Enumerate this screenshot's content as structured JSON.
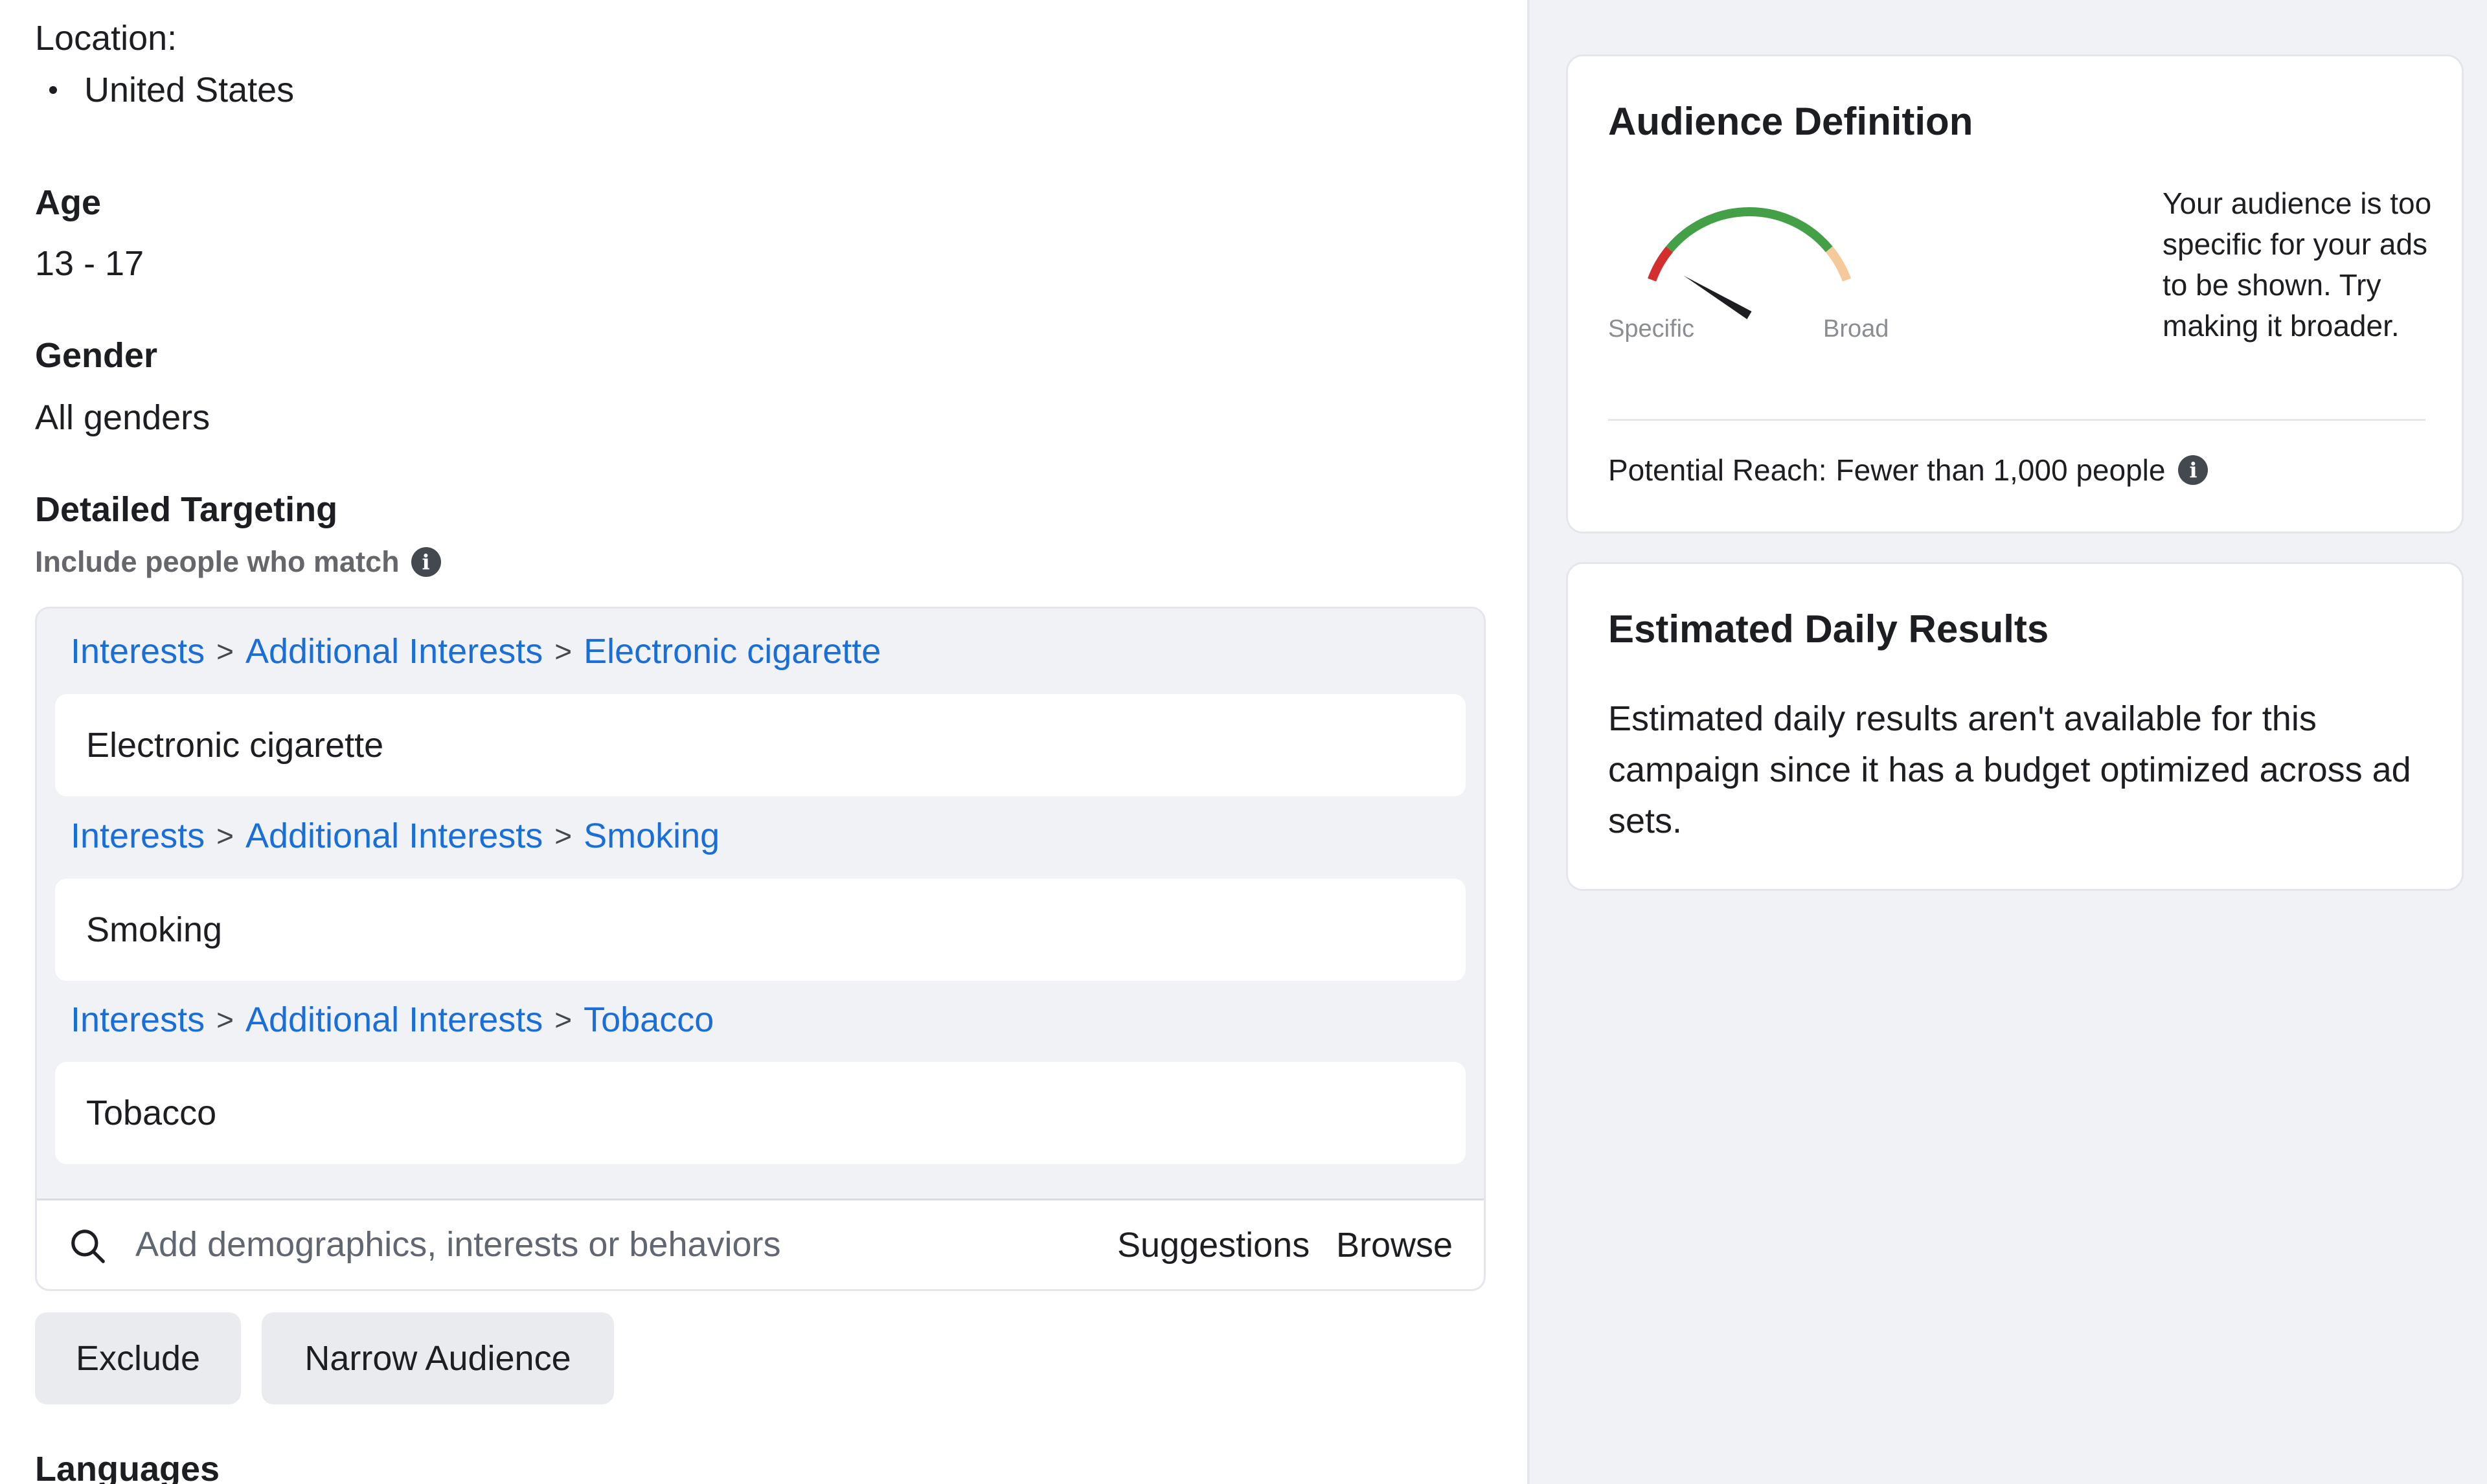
{
  "targeting": {
    "location_label": "Location:",
    "locations": [
      "United States"
    ],
    "age_label": "Age",
    "age_value": "13 - 17",
    "gender_label": "Gender",
    "gender_value": "All genders",
    "detailed_label": "Detailed Targeting",
    "include_label": "Include people who match",
    "interests": [
      {
        "path": [
          "Interests",
          "Additional Interests",
          "Electronic cigarette"
        ],
        "name": "Electronic cigarette"
      },
      {
        "path": [
          "Interests",
          "Additional Interests",
          "Smoking"
        ],
        "name": "Smoking"
      },
      {
        "path": [
          "Interests",
          "Additional Interests",
          "Tobacco"
        ],
        "name": "Tobacco"
      }
    ],
    "search_placeholder": "Add demographics, interests or behaviors",
    "suggestions_label": "Suggestions",
    "browse_label": "Browse",
    "exclude_label": "Exclude",
    "narrow_label": "Narrow Audience",
    "languages_label": "Languages"
  },
  "audience_definition": {
    "title": "Audience Definition",
    "gauge": {
      "specific_label": "Specific",
      "broad_label": "Broad",
      "level": 0.08,
      "colors": {
        "specific": "#d32f2f",
        "middle": "#43a047",
        "broad": "#f5c99a",
        "needle": "#1c1e21"
      }
    },
    "message": "Your audience is too specific for your ads to be shown. Try making it broader.",
    "reach_label": "Potential Reach:",
    "reach_value": "Fewer than 1,000 people"
  },
  "daily_results": {
    "title": "Estimated Daily Results",
    "text": "Estimated daily results aren't available for this campaign since it has a budget optimized across ad sets."
  },
  "colors": {
    "link": "#1a6ed8",
    "panel_bg": "#f0f2f5",
    "button_bg": "#e9ebee",
    "info_icon": "#444950"
  },
  "icons": [
    "info-icon",
    "search-icon"
  ]
}
